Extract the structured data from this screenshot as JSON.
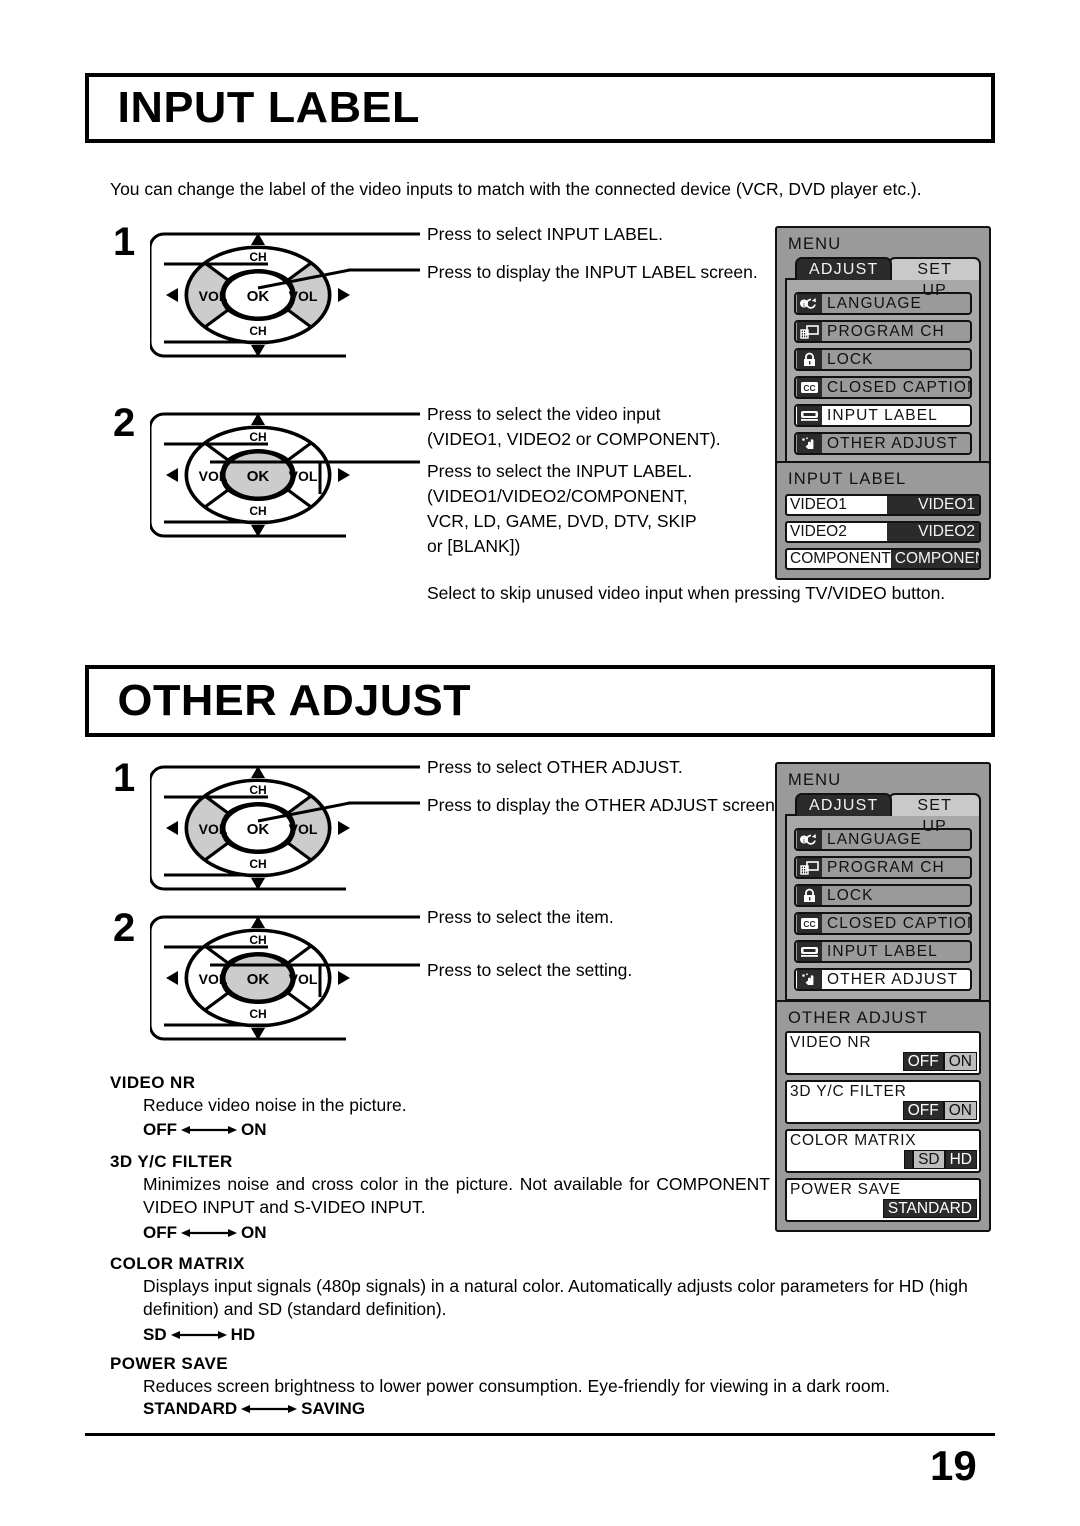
{
  "sections": [
    {
      "id": "input-label",
      "title": "INPUT LABEL",
      "intro": "You can change the label of the video inputs to match with the connected device (VCR, DVD player etc.).",
      "note": "Select to skip unused video input when pressing TV/VIDEO button.",
      "steps": [
        {
          "num": "1",
          "lines": [
            "Press to select INPUT LABEL.",
            "Press to display the INPUT LABEL screen."
          ],
          "highlight": "vol"
        },
        {
          "num": "2",
          "lines": [
            "Press to select the video input",
            "(VIDEO1, VIDEO2 or COMPONENT).",
            "Press to select the INPUT LABEL.",
            "(VIDEO1/VIDEO2/COMPONENT,",
            "VCR, LD, GAME, DVD, DTV, SKIP",
            "or [BLANK])"
          ],
          "highlight": "ok"
        }
      ]
    },
    {
      "id": "other-adjust",
      "title": "OTHER ADJUST",
      "steps": [
        {
          "num": "1",
          "lines": [
            "Press to select OTHER ADJUST.",
            "Press to display the OTHER ADJUST screen."
          ],
          "highlight": "vol"
        },
        {
          "num": "2",
          "lines": [
            "Press to select the item.",
            "Press to select the setting."
          ],
          "highlight": "ok"
        }
      ]
    }
  ],
  "remote": {
    "ok_label": "OK",
    "vol_left_label": "VOL",
    "vol_right_label": "VOL",
    "ch_up_label": "CH",
    "ch_down_label": "CH"
  },
  "menu_screen": {
    "title": "MENU",
    "tabs": [
      {
        "label": "ADJUST",
        "active": true
      },
      {
        "label": "SET UP",
        "active": false
      }
    ],
    "items": [
      {
        "label": "LANGUAGE",
        "icon": "language-icon"
      },
      {
        "label": "PROGRAM  CH",
        "icon": "program-ch-icon"
      },
      {
        "label": "LOCK",
        "icon": "lock-icon"
      },
      {
        "label": "CLOSED  CAPTION",
        "icon": "closed-caption-icon"
      },
      {
        "label": "INPUT  LABEL",
        "icon": "input-label-icon"
      },
      {
        "label": "OTHER  ADJUST",
        "icon": "other-adjust-icon"
      }
    ],
    "selected_for_input_label": 4,
    "selected_for_other_adjust": 5
  },
  "input_label_screen": {
    "title": "INPUT  LABEL",
    "rows": [
      {
        "name": "VIDEO1",
        "value": "VIDEO1"
      },
      {
        "name": "VIDEO2",
        "value": "VIDEO2"
      },
      {
        "name": "COMPONENT",
        "value": "COMPONENT"
      }
    ]
  },
  "other_adjust_screen": {
    "title": "OTHER  ADJUST",
    "items": [
      {
        "name": "VIDEO NR",
        "options": [
          {
            "label": "OFF",
            "selected": true
          },
          {
            "label": "ON",
            "selected": false
          }
        ]
      },
      {
        "name": "3D  Y/C  FILTER",
        "options": [
          {
            "label": "OFF",
            "selected": true
          },
          {
            "label": "ON",
            "selected": false
          }
        ]
      },
      {
        "name": "COLOR  MATRIX",
        "options": [
          {
            "label": "SD",
            "selected": false
          },
          {
            "label": "HD",
            "selected": true
          }
        ]
      },
      {
        "name": "POWER SAVE",
        "options": [
          {
            "label": "STANDARD",
            "selected": true
          }
        ]
      }
    ]
  },
  "descriptions": [
    {
      "heading": "VIDEO NR",
      "body": "Reduce video noise in the picture.",
      "values": {
        "left": "OFF",
        "right": "ON"
      }
    },
    {
      "heading": "3D Y/C FILTER",
      "body": "Minimizes noise and cross color in the picture. Not available for COMPONENT VIDEO INPUT and S-VIDEO INPUT.",
      "values": {
        "left": "OFF",
        "right": "ON"
      }
    },
    {
      "heading": "COLOR MATRIX",
      "body": "Displays input signals (480p signals) in a natural color.  Automatically adjusts color parameters for HD (high definition) and SD (standard definition).",
      "values": {
        "left": "SD",
        "right": "HD"
      }
    },
    {
      "heading": "POWER SAVE",
      "body": "Reduces screen brightness to lower power consumption. Eye-friendly for viewing in a dark room.",
      "values": {
        "left": "STANDARD",
        "right": "SAVING"
      }
    }
  ],
  "footer": {
    "page_number": "19"
  },
  "colors": {
    "osd_bg": "#9a9a9a",
    "osd_panel": "#a8a8a8",
    "osd_dark": "#2b2b2b",
    "osd_selected": "#ffffff",
    "pad_highlight": "#cccccc"
  }
}
